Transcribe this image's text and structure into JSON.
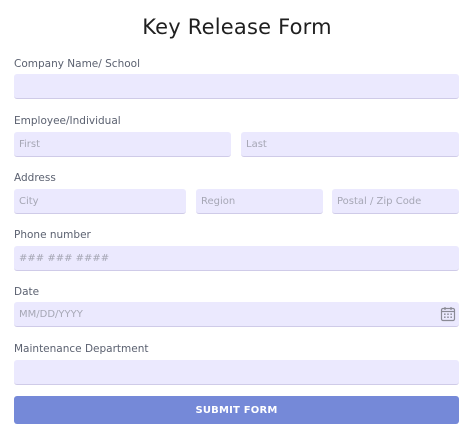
{
  "form": {
    "title": "Key Release Form",
    "submit_label": "SUBMIT FORM"
  },
  "company": {
    "label": "Company Name/ School",
    "value": "",
    "placeholder": ""
  },
  "employee": {
    "label": "Employee/Individual",
    "first_placeholder": "First",
    "last_placeholder": "Last"
  },
  "address": {
    "label": "Address",
    "city_placeholder": "City",
    "region_placeholder": "Region",
    "postal_placeholder": "Postal / Zip Code"
  },
  "phone": {
    "label": "Phone number",
    "placeholder": "### ### ####"
  },
  "date": {
    "label": "Date",
    "placeholder": "MM/DD/YYYY",
    "icon": "calendar-icon"
  },
  "department": {
    "label": "Maintenance Department",
    "placeholder": ""
  },
  "colors": {
    "field_background": "#ebe9fe",
    "submit_background": "#7589d8",
    "label_text": "#5b6170"
  }
}
